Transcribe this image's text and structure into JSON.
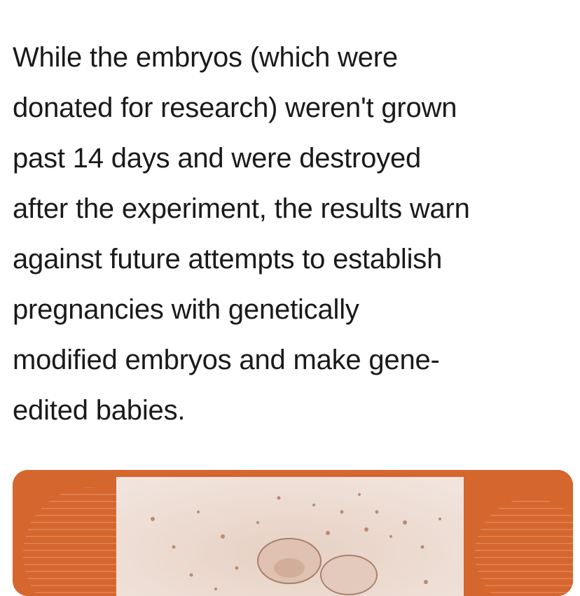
{
  "article": {
    "paragraph_lines": [
      "While the embryos (which were",
      "donated for research) weren't grown",
      "past 14 days and were destroyed",
      "after the experiment, the results warn",
      "against future attempts to establish",
      "pregnancies with genetically",
      "modified embryos and make gene-",
      "edited babies."
    ]
  },
  "image": {
    "subject": "embryo-micrograph",
    "frame_color": "#d4662e",
    "photo_tint": "#ead8cf"
  }
}
